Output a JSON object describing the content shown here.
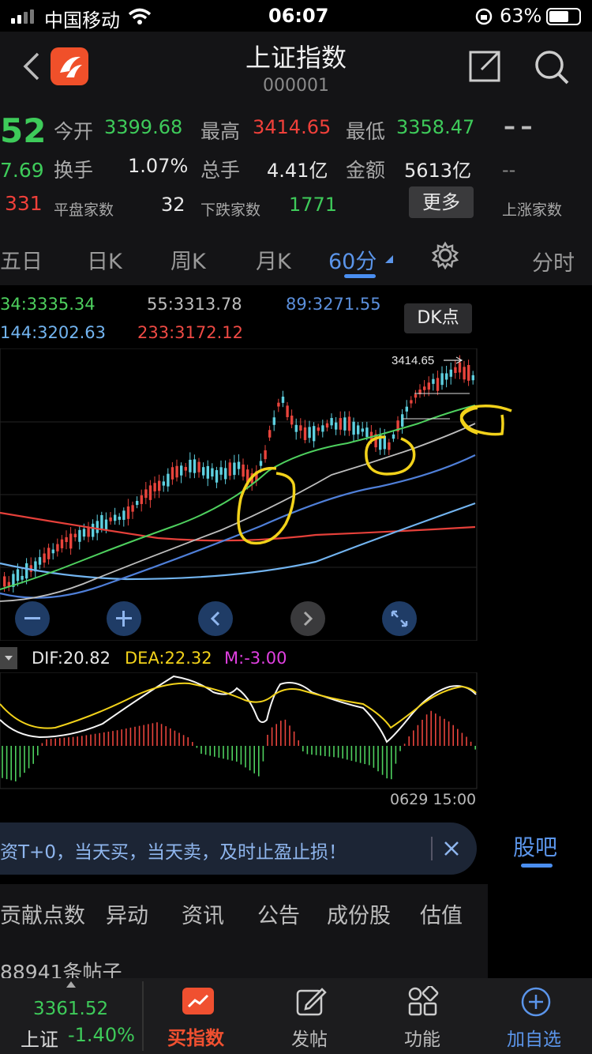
{
  "status": {
    "carrier": "中国移动",
    "time": "06:07",
    "battery": "63%"
  },
  "header": {
    "title": "上证指数",
    "code": "000001",
    "back_icon": "chevron-left-icon",
    "share_icon": "share-icon",
    "search_icon": "search-icon"
  },
  "quote": {
    "price_partial": "52",
    "change_partial": "7.69",
    "up_count_partial": "331",
    "open_label": "今开",
    "open_value": "3399.68",
    "high_label": "最高",
    "high_value": "3414.65",
    "low_label": "最低",
    "low_value": "3358.47",
    "turnover_label": "换手",
    "turnover_value": "1.07%",
    "volume_label": "总手",
    "volume_value": "4.41亿",
    "amount_label": "金额",
    "amount_value": "5613亿",
    "flat_label": "平盘家数",
    "flat_value": "32",
    "down_label": "下跌家数",
    "down_value": "1771",
    "more_button": "更多",
    "right_dash1": "– –",
    "right_dash2": "--",
    "rise_label": "上涨家数"
  },
  "tabs": [
    {
      "label": "五日"
    },
    {
      "label": "日K"
    },
    {
      "label": "周K"
    },
    {
      "label": "月K"
    },
    {
      "label": "60分"
    },
    {
      "label": "分时"
    }
  ],
  "ma": {
    "ma34": "34:3335.34",
    "ma55": "55:3313.78",
    "ma89": "89:3271.55",
    "ma144": "144:3202.63",
    "ma233": "233:3172.12",
    "dk_button": "DK点"
  },
  "chart": {
    "high_marker": "3414.65",
    "date_label": "0629 15:00"
  },
  "macd": {
    "dif": "DIF:20.82",
    "dea": "DEA:22.32",
    "m": "M:-3.00"
  },
  "banner": {
    "text": "资T+0，当天买，当天卖，及时止盈止损！"
  },
  "guba": {
    "label": "股吧"
  },
  "bottom_tabs": [
    "贡献点数",
    "异动",
    "资讯",
    "公告",
    "成份股",
    "估值"
  ],
  "posts": {
    "count_text": "88941条帖子"
  },
  "nav": {
    "index_value": "3361.52",
    "index_name": "上证",
    "index_change": "-1.40%",
    "buy": "买指数",
    "post": "发帖",
    "func": "功能",
    "add": "加自选"
  },
  "colors": {
    "up": "#f0403a",
    "down": "#3ecb5a",
    "accent": "#4a8ef0",
    "annotation": "#f2d21a"
  }
}
